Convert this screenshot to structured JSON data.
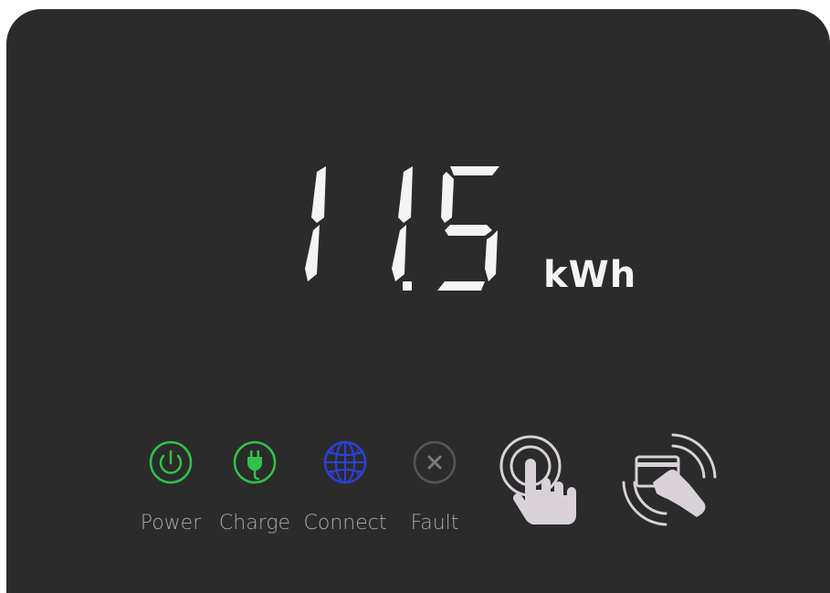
{
  "display": {
    "value": "11.5",
    "unit": "kWh"
  },
  "indicators": [
    {
      "label": "Power",
      "icon": "power-icon",
      "color": "#2fc24a"
    },
    {
      "label": "Charge",
      "icon": "plug-icon",
      "color": "#2fc24a"
    },
    {
      "label": "Connect",
      "icon": "globe-icon",
      "color": "#2b3fd6"
    },
    {
      "label": "Fault",
      "icon": "close-icon",
      "color": "#7a7a7a"
    }
  ],
  "buttons": [
    {
      "icon": "touch-hand-icon",
      "color": "#d8d2d8"
    },
    {
      "icon": "card-tap-icon",
      "color": "#d8d2d8"
    }
  ],
  "colors": {
    "panel": "#2b2b2b",
    "segment": "#f4f4f4",
    "label": "#a8a8a8"
  }
}
